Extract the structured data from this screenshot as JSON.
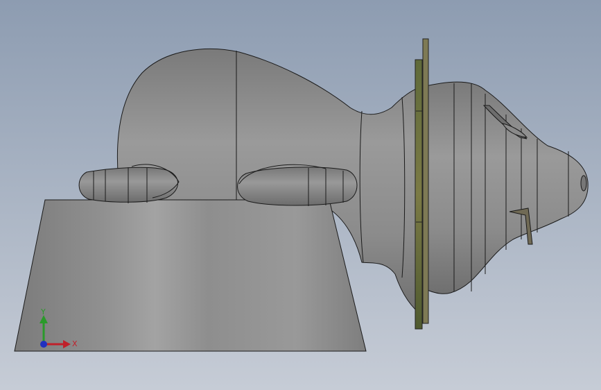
{
  "viewport": {
    "background_top": "#8d9cb1",
    "background_bottom": "#c6ccd6",
    "model_color": "#8a8a8a",
    "edge_color": "#1a1a1a",
    "flange_color": "#6b6b3a"
  },
  "triad": {
    "x_label": "X",
    "y_label": "Y",
    "x_color": "#c0202a",
    "y_color": "#2a9a2a",
    "z_color": "#2030c0"
  }
}
